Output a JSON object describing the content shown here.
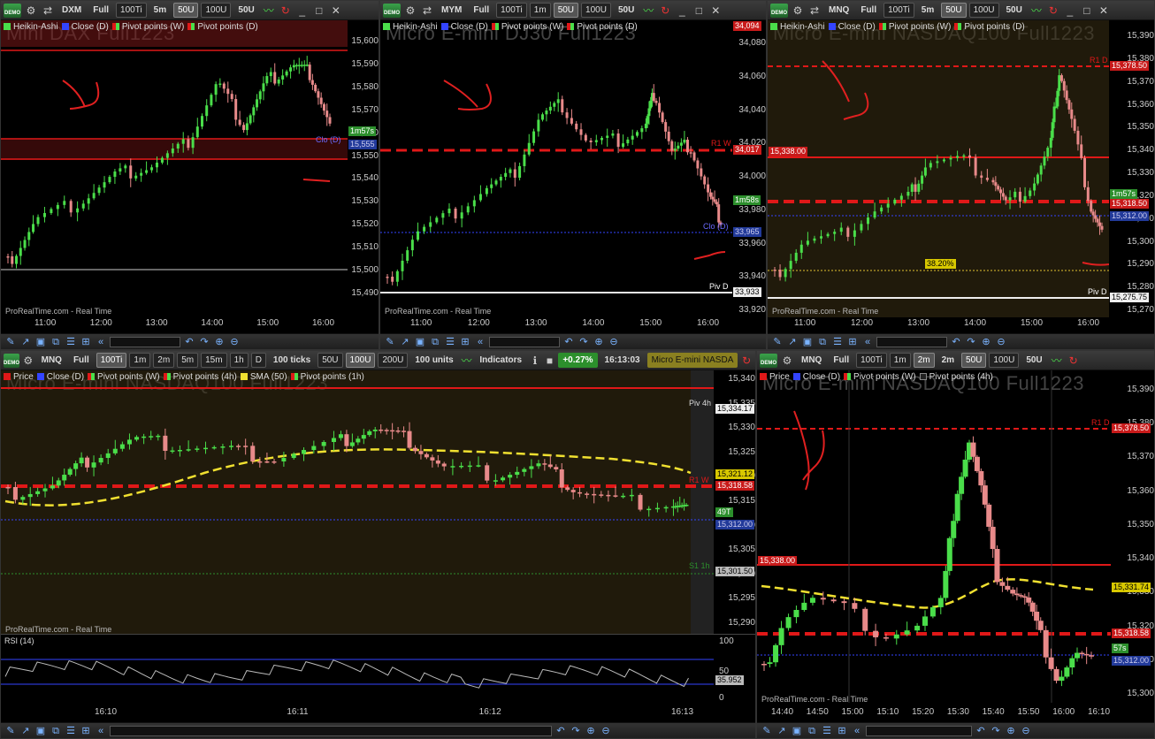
{
  "credit": "ProRealTime.com - Real Time",
  "panels": {
    "p1": {
      "symbol": "DXM",
      "mode": "Full",
      "ticks": "100Ti",
      "timeframe": "5m",
      "units_sel": "50U",
      "units2": "100U",
      "units3": "50U",
      "legend": [
        "Heikin-Ashi",
        "Close (D)",
        "Pivot points (W)",
        "Pivot points (D)"
      ],
      "watermark": "Mini DAX Full1223",
      "yticks": [
        "15,600",
        "15,590",
        "15,580",
        "15,570",
        "15,560",
        "15,550",
        "15,540",
        "15,530",
        "15,520",
        "15,510",
        "15,500",
        "15,490"
      ],
      "tag_time": "1m57s",
      "tag_price": "15,555",
      "tag_clo": "Clo (D)",
      "xticks": [
        "11:00",
        "12:00",
        "13:00",
        "14:00",
        "15:00",
        "16:00"
      ]
    },
    "p2": {
      "symbol": "MYM",
      "mode": "Full",
      "ticks": "100Ti",
      "timeframe": "1m",
      "units_sel": "50U",
      "units2": "100U",
      "units3": "50U",
      "legend": [
        "Heikin-Ashi",
        "Close (D)",
        "Pivot points (W)",
        "Pivot points (D)"
      ],
      "watermark": "Micro E-mini DJ30 Full1223",
      "yticks": [
        "34,080",
        "34,060",
        "34,040",
        "34,020",
        "34,000",
        "33,980",
        "33,960",
        "33,940",
        "33,920"
      ],
      "tag_top": "34,094",
      "tag_r1w_price": "34,017",
      "tag_r1w": "R1 W",
      "tag_time": "1m58s",
      "tag_clo_price": "33,965",
      "tag_clo": "Clo (D)",
      "tag_piv": "Piv D",
      "tag_piv_price": "33,933",
      "xticks": [
        "11:00",
        "12:00",
        "13:00",
        "14:00",
        "15:00",
        "16:00"
      ]
    },
    "p3": {
      "symbol": "MNQ",
      "mode": "Full",
      "ticks": "100Ti",
      "timeframe": "5m",
      "units_sel": "50U",
      "units2": "100U",
      "units3": "50U",
      "legend": [
        "Heikin-Ashi",
        "Close (D)",
        "Pivot points (W)",
        "Pivot points (D)"
      ],
      "watermark": "Micro E-mini NASDAQ100 Full1223",
      "yticks": [
        "15,390",
        "15,380",
        "15,370",
        "15,360",
        "15,350",
        "15,340",
        "15,330",
        "15,320",
        "15,310",
        "15,300",
        "15,290",
        "15,280",
        "15,270"
      ],
      "tag_r1d_price": "15,378.50",
      "tag_r1d": "R1 D",
      "tag_left": "15,338.00",
      "tag_time": "1m57s",
      "tag_r1w_price": "15,318.50",
      "tag_blue": "15,312.00",
      "tag_fib": "38.20%",
      "tag_piv": "Piv D",
      "tag_piv_price": "15,275.75",
      "xticks": [
        "11:00",
        "12:00",
        "13:00",
        "14:00",
        "15:00",
        "16:00"
      ]
    },
    "p4": {
      "symbol": "MNQ",
      "mode": "Full",
      "ticks": "100Ti",
      "t1": "1m",
      "t2": "2m",
      "t3": "5m",
      "t4": "15m",
      "t5": "1h",
      "t6": "D",
      "ticks_sel": "100 ticks",
      "u1": "50U",
      "u2": "100U",
      "u3": "200U",
      "units": "100 units",
      "indicators": "Indicators",
      "change": "+0.27%",
      "clock": "16:13:03",
      "instrument": "Micro E-mini NASDA",
      "legend": [
        "Price",
        "Close (D)",
        "Pivot points (W)",
        "Pivot points (4h)",
        "SMA (50)",
        "Pivot points (1h)"
      ],
      "watermark": "Micro E-mini NASDAQ100 Full1223",
      "yticks": [
        "15,340",
        "15,335",
        "15,330",
        "15,325",
        "15,320",
        "15,315",
        "15,310",
        "15,305",
        "15,300",
        "15,295",
        "15,290"
      ],
      "tag_piv4h": "Piv 4h",
      "tag_piv4h_price": "15,334.17",
      "tag_sma": "15,321.12",
      "tag_r1w": "R1 W",
      "tag_r1w_price": "15,318.58",
      "tag_time": "49T",
      "tag_blue": "15,312.00",
      "tag_s1": "S1 1h",
      "tag_s1_price": "15,301.50",
      "rsi_label": "RSI (14)",
      "rsi_ticks": [
        "100",
        "50",
        "0"
      ],
      "rsi_value": "35.952",
      "xticks": [
        "16:10",
        "16:11",
        "16:12",
        "16:13"
      ]
    },
    "p5": {
      "symbol": "MNQ",
      "mode": "Full",
      "ticks": "100Ti",
      "t1": "1m",
      "t2": "2m",
      "timeframe": "2m",
      "units_sel": "50U",
      "units2": "100U",
      "units3": "50U",
      "legend": [
        "Price",
        "Close (D)",
        "Pivot points (W)",
        "Pivot points (4h)"
      ],
      "watermark": "Micro E-mini NASDAQ100 Full1223",
      "yticks": [
        "15,390",
        "15,380",
        "15,370",
        "15,360",
        "15,350",
        "15,340",
        "15,330",
        "15,320",
        "15,310",
        "15,300"
      ],
      "tag_r1d_price": "15,378.50",
      "tag_r1d": "R1 D",
      "tag_left": "15,338.00",
      "tag_sma": "15,331.74",
      "tag_r1w_price": "15,318.58",
      "tag_time": "57s",
      "tag_blue": "15,312.00",
      "xticks": [
        "14:40",
        "14:50",
        "15:00",
        "15:10",
        "15:20",
        "15:30",
        "15:40",
        "15:50",
        "16:00",
        "16:10"
      ]
    }
  },
  "colors": {
    "bull": "#4ade4a",
    "bear": "#e88a8a",
    "pivot_red": "#e01818",
    "sma": "#f0e030",
    "close_blue": "#3344ff",
    "annot": "#e02020"
  }
}
